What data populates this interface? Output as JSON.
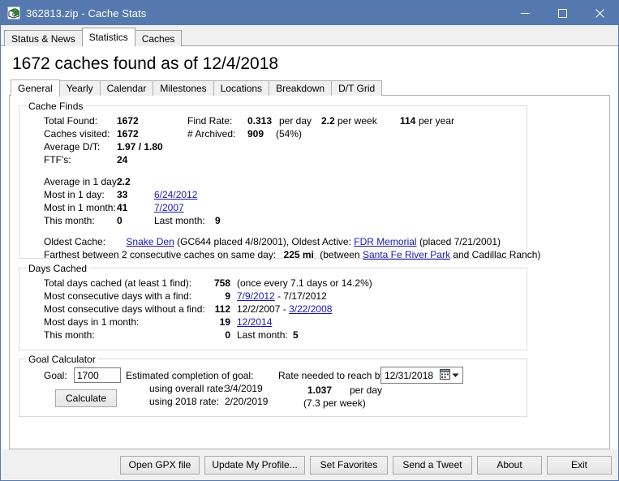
{
  "window": {
    "title": "362813.zip - Cache Stats",
    "icon": "archive-box-icon",
    "minimize_label": "─",
    "maximize_label": "□",
    "close_label": "✕"
  },
  "top_tabs": [
    {
      "label": "Status & News",
      "active": false
    },
    {
      "label": "Statistics",
      "active": true
    },
    {
      "label": "Caches",
      "active": false
    }
  ],
  "headline": "1672 caches found as of 12/4/2018",
  "inner_tabs": [
    {
      "label": "General",
      "active": true
    },
    {
      "label": "Yearly",
      "active": false
    },
    {
      "label": "Calendar",
      "active": false
    },
    {
      "label": "Milestones",
      "active": false
    },
    {
      "label": "Locations",
      "active": false
    },
    {
      "label": "Breakdown",
      "active": false
    },
    {
      "label": "D/T Grid",
      "active": false
    }
  ],
  "cache_finds": {
    "legend": "Cache Finds",
    "total_found_label": "Total Found:",
    "total_found_value": "1672",
    "caches_visited_label": "Caches visited:",
    "caches_visited_value": "1672",
    "average_dt_label": "Average D/T:",
    "average_dt_value": "1.97 / 1.80",
    "ftf_label": "FTF's:",
    "ftf_value": "24",
    "find_rate_label": "Find Rate:",
    "find_rate_value": "0.313",
    "find_rate_unit": "per day",
    "per_week_value": "2.2",
    "per_week_unit": "per week",
    "per_year_value": "114",
    "per_year_unit": "per year",
    "archived_label": "# Archived:",
    "archived_value": "909",
    "archived_pct": "(54%)",
    "average_in_1_day_label": "Average in 1 day:",
    "average_in_1_day_value": "2.2",
    "most_in_1_day_label": "Most in 1 day:",
    "most_in_1_day_value": "33",
    "most_in_1_day_link": "6/24/2012",
    "most_in_1_month_label": "Most in 1 month:",
    "most_in_1_month_value": "41",
    "most_in_1_month_link": "7/2007",
    "this_month_label": "This month:",
    "this_month_value": "0",
    "last_month_label": "Last month:",
    "last_month_value": "9",
    "oldest_cache_label": "Oldest Cache:",
    "oldest_cache_link": "Snake Den",
    "oldest_cache_detail": "(GC644 placed 4/8/2001), Oldest Active:",
    "oldest_active_link": "FDR Memorial",
    "oldest_active_detail": "(placed 7/21/2001)",
    "farthest_label": "Farthest between 2 consecutive caches on same day:",
    "farthest_value": "225 mi",
    "farthest_between_pre": "(between",
    "farthest_link": "Santa Fe River Park",
    "farthest_post": "and Cadillac Ranch)"
  },
  "days_cached": {
    "legend": "Days Cached",
    "total_days_label": "Total days cached (at least 1 find):",
    "total_days_value": "758",
    "total_days_note": "(once every 7.1 days or 14.2%)",
    "consec_with_label": "Most consecutive days with a find:",
    "consec_with_value": "9",
    "consec_with_link": "7/9/2012",
    "consec_with_suffix": "- 7/17/2012",
    "consec_without_label": "Most consecutive days without a find:",
    "consec_without_value": "112",
    "consec_without_prefix": "12/2/2007 -",
    "consec_without_link": "3/22/2008",
    "most_days_month_label": "Most days in 1 month:",
    "most_days_month_value": "19",
    "most_days_month_link": "12/2014",
    "this_month_label": "This month:",
    "this_month_value": "0",
    "last_month_label": "Last month:",
    "last_month_value": "5"
  },
  "goal_calculator": {
    "legend": "Goal Calculator",
    "goal_label": "Goal:",
    "goal_value": "1700",
    "calculate_label": "Calculate",
    "estimated_label": "Estimated completion of goal:",
    "overall_rate_label": "using overall rate:",
    "overall_rate_value": "3/4/2019",
    "year_rate_label": "using 2018 rate:",
    "year_rate_value": "2/20/2019",
    "rate_needed_label": "Rate needed to reach by:",
    "rate_needed_date": "12/31/2018",
    "rate_needed_value": "1.037",
    "rate_needed_unit": "per day",
    "rate_needed_week": "(7.3 per week)",
    "calendar_icon": "calendar-icon",
    "dropdown_icon": "chevron-down-icon"
  },
  "bottom_buttons": [
    {
      "label": "Open GPX file",
      "name": "open-gpx-file-button",
      "width": 98
    },
    {
      "label": "Update My Profile...",
      "name": "update-my-profile-button",
      "width": 124
    },
    {
      "label": "Set Favorites",
      "name": "set-favorites-button",
      "width": 96
    },
    {
      "label": "Send a Tweet",
      "name": "send-a-tweet-button",
      "width": 98
    },
    {
      "label": "About",
      "name": "about-button",
      "width": 80
    },
    {
      "label": "Exit",
      "name": "exit-button",
      "width": 80
    }
  ],
  "colors": {
    "titlebar": "#5579ae",
    "link": "#1818b0",
    "panel": "#f0f0f0"
  }
}
